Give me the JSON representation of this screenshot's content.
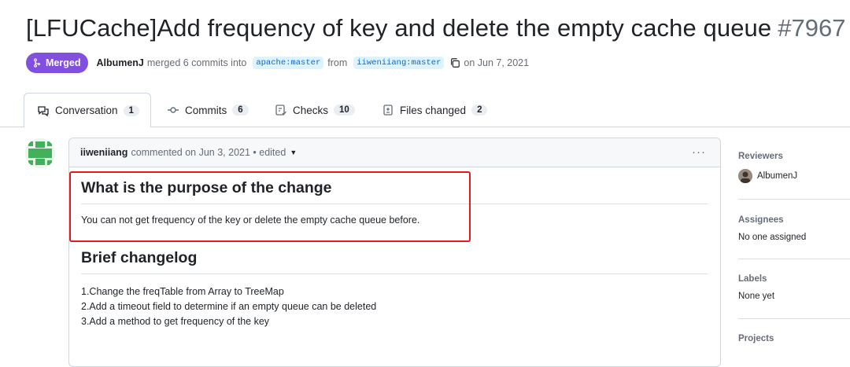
{
  "title": "[LFUCache]Add frequency of key and delete the empty cache queue",
  "pr_number": "#7967",
  "meta": {
    "status": "Merged",
    "author": "AlbumenJ",
    "action": "merged 6 commits into",
    "base_branch": "apache:master",
    "from_word": "from",
    "head_branch": "iiweniiang:master",
    "date_text": "on Jun 7, 2021"
  },
  "tabs": [
    {
      "label": "Conversation",
      "count": "1"
    },
    {
      "label": "Commits",
      "count": "6"
    },
    {
      "label": "Checks",
      "count": "10"
    },
    {
      "label": "Files changed",
      "count": "2"
    }
  ],
  "comment": {
    "author": "iiweniiang",
    "meta": "commented on Jun 3, 2021 • edited",
    "heading1": "What is the purpose of the change",
    "paragraph1": "You can not get frequency of the key or delete the empty cache queue before.",
    "heading2": "Brief changelog",
    "changelog": [
      "1.Change the freqTable from Array to TreeMap",
      "2.Add a timeout field to determine if an empty queue can be deleted",
      "3.Add a method to get frequency of the key"
    ]
  },
  "sidebar": {
    "reviewers": {
      "heading": "Reviewers",
      "value": "AlbumenJ"
    },
    "assignees": {
      "heading": "Assignees",
      "value": "No one assigned"
    },
    "labels": {
      "heading": "Labels",
      "value": "None yet"
    },
    "projects": {
      "heading": "Projects"
    }
  },
  "colors": {
    "merged": "#8250df",
    "highlight": "#e11b1b",
    "branch_bg": "#ddf4ff",
    "link": "#0969da"
  }
}
